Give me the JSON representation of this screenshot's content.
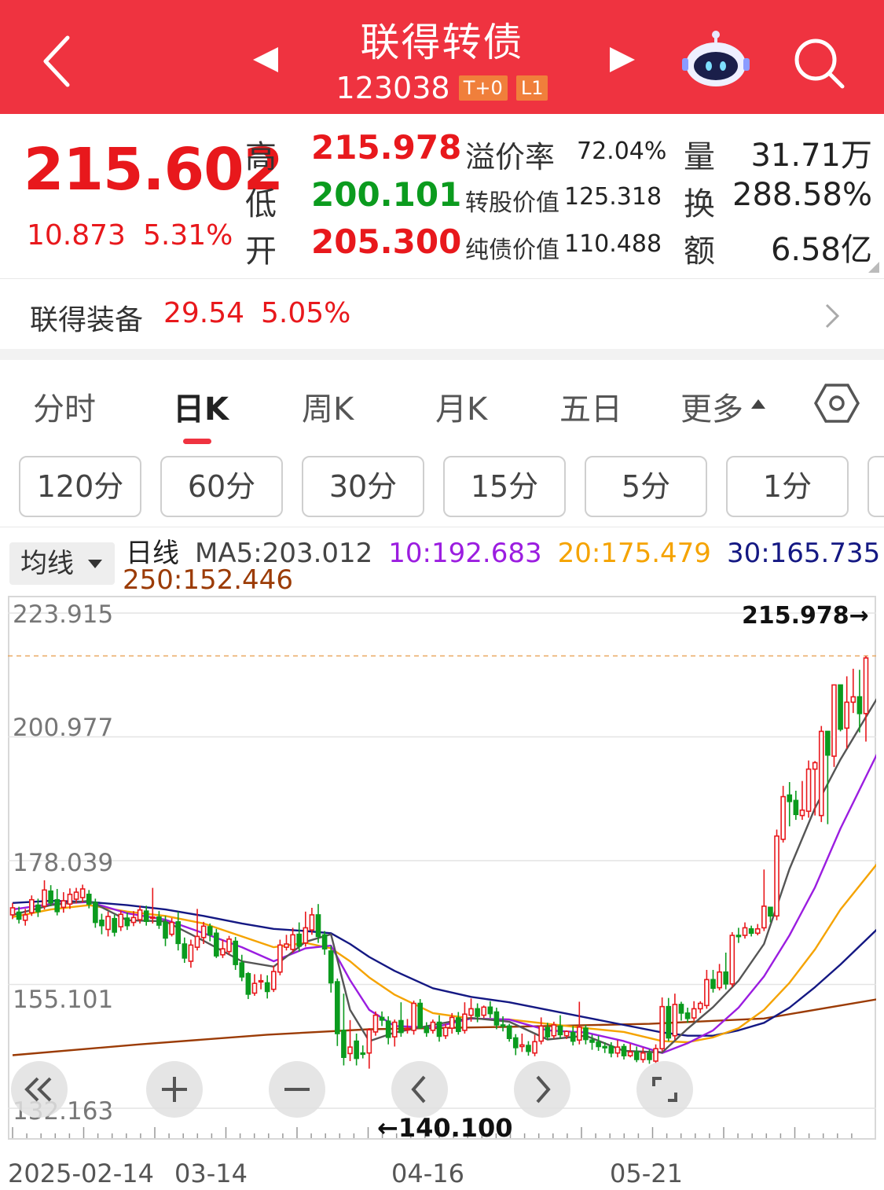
{
  "header": {
    "title": "联得转债",
    "code": "123038",
    "badge_t0": "T+0",
    "badge_l1": "L1"
  },
  "quote": {
    "price": "215.602",
    "change": "10.873",
    "change_pct": "5.31%",
    "high_label": "高",
    "high": "215.978",
    "low_label": "低",
    "low": "200.101",
    "open_label": "开",
    "open": "205.300",
    "premium_label": "溢价率",
    "premium": "72.04%",
    "conv_value_label": "转股价值",
    "conv_value": "125.318",
    "bond_value_label": "纯债价值",
    "bond_value": "110.488",
    "volume_label": "量",
    "volume": "31.71万",
    "turnover_label": "换",
    "turnover": "288.58%",
    "amount_label": "额",
    "amount": "6.58亿"
  },
  "underlying": {
    "name": "联得装备",
    "price": "29.54",
    "change_pct": "5.05%"
  },
  "tabs": {
    "items": [
      "分时",
      "日K",
      "周K",
      "月K",
      "五日",
      "更多"
    ],
    "active": "日K"
  },
  "intervals": [
    "120分",
    "60分",
    "30分",
    "15分",
    "5分",
    "1分"
  ],
  "ma": {
    "button": "均线",
    "period": "日线",
    "ma5": "MA5:203.012",
    "ma10": "10:192.683",
    "ma20": "20:175.479",
    "ma30": "30:165.735",
    "ma250": "250:152.446"
  },
  "colors": {
    "header_bg": "#ef3340",
    "up": "#e8181c",
    "down": "#0b9b1e",
    "ma5": "#555555",
    "ma10": "#9b1de0",
    "ma20": "#f5a300",
    "ma30": "#141883",
    "ma250": "#9b3b05"
  },
  "icons": [
    "back-icon",
    "prev-icon",
    "next-icon",
    "robot-icon",
    "search-icon",
    "chevron-right-icon",
    "settings-hex-icon",
    "double-left-icon",
    "zoom-in-icon",
    "zoom-out-icon",
    "scroll-left-icon",
    "scroll-right-icon",
    "fullscreen-icon"
  ],
  "chart_data": {
    "type": "candlestick",
    "y_ticks": [
      "223.915",
      "200.977",
      "178.039",
      "155.101",
      "132.163"
    ],
    "ylim": [
      132.163,
      223.915
    ],
    "x_ticks": [
      "2025-02-14",
      "03-14",
      "04-16",
      "05-21"
    ],
    "high_marker": "215.978→",
    "low_marker": "←140.100",
    "candles": [
      [
        168.0,
        169.3,
        170.2,
        167.2
      ],
      [
        168.5,
        167.2,
        169.5,
        166.4
      ],
      [
        167.0,
        168.0,
        169.1,
        166.0
      ],
      [
        168.4,
        170.8,
        171.6,
        167.8
      ],
      [
        169.8,
        168.6,
        171.0,
        167.6
      ],
      [
        169.6,
        172.6,
        174.4,
        169.0
      ],
      [
        172.4,
        170.2,
        173.5,
        169.6
      ],
      [
        170.8,
        168.6,
        172.8,
        167.9
      ],
      [
        169.4,
        170.6,
        172.2,
        168.4
      ],
      [
        170.0,
        171.8,
        172.9,
        169.1
      ],
      [
        170.9,
        172.2,
        173.0,
        170.1
      ],
      [
        171.2,
        172.8,
        173.6,
        170.3
      ],
      [
        171.8,
        170.0,
        172.6,
        169.2
      ],
      [
        170.3,
        166.6,
        171.0,
        165.6
      ],
      [
        167.0,
        166.0,
        168.2,
        164.4
      ],
      [
        165.3,
        167.7,
        168.6,
        164.0
      ],
      [
        167.3,
        164.8,
        168.0,
        164.0
      ],
      [
        165.8,
        168.1,
        168.8,
        165.0
      ],
      [
        167.4,
        166.0,
        168.4,
        165.2
      ],
      [
        166.6,
        167.5,
        168.7,
        165.9
      ],
      [
        167.1,
        168.9,
        169.7,
        166.4
      ],
      [
        168.7,
        166.8,
        169.7,
        166.0
      ],
      [
        167.5,
        167.6,
        173.0,
        166.4
      ],
      [
        167.6,
        166.1,
        168.7,
        165.4
      ],
      [
        166.6,
        163.7,
        167.8,
        162.2
      ],
      [
        164.4,
        166.6,
        167.4,
        164.0
      ],
      [
        166.7,
        162.7,
        168.6,
        161.4
      ],
      [
        162.6,
        160.0,
        163.8,
        159.1
      ],
      [
        159.4,
        162.4,
        163.4,
        158.2
      ],
      [
        162.0,
        164.0,
        169.1,
        161.4
      ],
      [
        163.8,
        165.9,
        166.7,
        162.6
      ],
      [
        165.8,
        164.3,
        166.4,
        163.1
      ],
      [
        164.6,
        160.4,
        165.4,
        160.0
      ],
      [
        160.6,
        161.7,
        163.4,
        160.0
      ],
      [
        161.2,
        163.5,
        164.1,
        160.6
      ],
      [
        163.1,
        158.8,
        163.9,
        157.8
      ],
      [
        159.1,
        156.5,
        160.6,
        155.7
      ],
      [
        157.1,
        153.3,
        157.4,
        152.4
      ],
      [
        153.5,
        155.3,
        157.0,
        153.0
      ],
      [
        155.6,
        155.8,
        157.0,
        154.2
      ],
      [
        155.4,
        153.8,
        156.8,
        152.5
      ],
      [
        154.2,
        157.5,
        158.6,
        153.7
      ],
      [
        157.4,
        162.4,
        163.4,
        156.8
      ],
      [
        162.0,
        162.6,
        164.3,
        161.4
      ],
      [
        161.6,
        164.3,
        165.6,
        161.0
      ],
      [
        164.4,
        162.2,
        166.6,
        161.2
      ],
      [
        162.8,
        165.6,
        168.6,
        162.1
      ],
      [
        165.2,
        168.0,
        169.3,
        164.3
      ],
      [
        168.0,
        164.0,
        170.0,
        162.8
      ],
      [
        164.3,
        161.7,
        165.0,
        160.6
      ],
      [
        161.3,
        155.4,
        162.3,
        153.6
      ],
      [
        155.6,
        146.0,
        156.2,
        143.7
      ],
      [
        146.6,
        141.6,
        153.4,
        140.1
      ],
      [
        142.3,
        143.5,
        148.5,
        140.9
      ],
      [
        144.6,
        141.4,
        146.0,
        140.1
      ],
      [
        142.4,
        142.2,
        143.8,
        141.4
      ],
      [
        142.4,
        146.7,
        147.0,
        139.5
      ],
      [
        146.3,
        149.4,
        150.1,
        145.6
      ],
      [
        149.0,
        148.5,
        150.1,
        147.4
      ],
      [
        148.3,
        145.3,
        149.2,
        144.0
      ],
      [
        145.4,
        148.1,
        148.6,
        143.6
      ],
      [
        148.4,
        146.2,
        151.8,
        145.4
      ],
      [
        146.8,
        146.9,
        148.7,
        146.0
      ],
      [
        146.6,
        151.6,
        152.1,
        145.8
      ],
      [
        151.6,
        147.1,
        152.4,
        146.8
      ],
      [
        147.2,
        146.2,
        148.1,
        145.4
      ],
      [
        146.6,
        148.1,
        148.6,
        146.0
      ],
      [
        148.1,
        145.5,
        149.4,
        144.5
      ],
      [
        145.6,
        147.1,
        147.8,
        145.0
      ],
      [
        147.0,
        149.0,
        149.8,
        146.0
      ],
      [
        148.9,
        146.4,
        150.0,
        145.8
      ],
      [
        146.6,
        149.6,
        151.8,
        146.0
      ],
      [
        149.4,
        150.6,
        152.5,
        148.2
      ],
      [
        150.6,
        149.2,
        151.6,
        148.1
      ],
      [
        149.4,
        150.9,
        151.2,
        148.9
      ],
      [
        150.9,
        149.7,
        152.0,
        148.9
      ],
      [
        150.0,
        147.6,
        150.8,
        146.8
      ],
      [
        147.6,
        147.4,
        149.2,
        146.4
      ],
      [
        147.4,
        145.1,
        147.8,
        144.5
      ],
      [
        145.2,
        143.4,
        145.9,
        142.0
      ],
      [
        143.6,
        143.9,
        146.0,
        142.6
      ],
      [
        143.8,
        142.7,
        144.6,
        141.9
      ],
      [
        142.4,
        144.5,
        145.8,
        141.8
      ],
      [
        144.6,
        147.4,
        149.0,
        144.0
      ],
      [
        147.1,
        145.4,
        148.0,
        144.8
      ],
      [
        145.6,
        147.6,
        148.2,
        145.1
      ],
      [
        147.4,
        145.8,
        149.4,
        145.0
      ],
      [
        145.6,
        146.4,
        146.6,
        145.0
      ],
      [
        146.2,
        144.6,
        147.4,
        143.8
      ],
      [
        144.8,
        147.2,
        151.9,
        144.0
      ],
      [
        147.0,
        144.9,
        147.6,
        144.0
      ],
      [
        144.8,
        144.4,
        145.8,
        143.0
      ],
      [
        144.4,
        143.6,
        145.6,
        142.8
      ],
      [
        143.6,
        143.5,
        144.4,
        142.4
      ],
      [
        143.6,
        142.4,
        144.4,
        141.6
      ],
      [
        142.4,
        143.5,
        144.8,
        141.6
      ],
      [
        143.6,
        141.9,
        144.1,
        141.2
      ],
      [
        141.9,
        142.6,
        144.1,
        141.6
      ],
      [
        142.6,
        141.2,
        143.6,
        140.7
      ],
      [
        141.2,
        142.4,
        143.4,
        140.6
      ],
      [
        142.3,
        141.2,
        143.1,
        140.4
      ],
      [
        140.9,
        143.2,
        144.0,
        140.5
      ],
      [
        143.2,
        151.0,
        152.7,
        142.7
      ],
      [
        151.0,
        145.2,
        152.6,
        144.6
      ],
      [
        145.6,
        151.4,
        153.4,
        144.8
      ],
      [
        151.4,
        149.8,
        151.9,
        148.4
      ],
      [
        149.8,
        148.8,
        150.8,
        148.0
      ],
      [
        148.9,
        150.6,
        152.0,
        148.4
      ],
      [
        150.6,
        151.6,
        152.0,
        149.8
      ],
      [
        151.2,
        156.0,
        157.8,
        150.6
      ],
      [
        156.0,
        154.4,
        157.8,
        153.6
      ],
      [
        154.5,
        157.4,
        158.9,
        154.0
      ],
      [
        157.4,
        155.2,
        161.0,
        154.2
      ],
      [
        155.2,
        164.2,
        164.8,
        154.6
      ],
      [
        164.2,
        164.0,
        165.6,
        162.8
      ],
      [
        164.2,
        165.6,
        166.6,
        163.6
      ],
      [
        165.4,
        164.6,
        166.0,
        164.0
      ],
      [
        164.6,
        165.4,
        166.3,
        164.2
      ],
      [
        165.6,
        169.6,
        176.4,
        165.0
      ],
      [
        169.4,
        167.8,
        169.4,
        166.6
      ],
      [
        167.8,
        182.6,
        183.8,
        167.0
      ],
      [
        182.0,
        189.9,
        191.9,
        181.4
      ],
      [
        190.2,
        189.0,
        192.6,
        184.4
      ],
      [
        189.2,
        186.6,
        191.0,
        185.6
      ],
      [
        186.4,
        187.4,
        192.8,
        185.6
      ],
      [
        187.2,
        195.0,
        196.6,
        186.0
      ],
      [
        195.0,
        196.2,
        196.5,
        186.4
      ],
      [
        186.4,
        202.0,
        203.0,
        185.2
      ],
      [
        202.0,
        197.6,
        202.0,
        184.8
      ],
      [
        197.4,
        210.6,
        210.6,
        195.4
      ],
      [
        210.6,
        202.4,
        210.6,
        202.0
      ],
      [
        202.6,
        207.4,
        212.2,
        198.8
      ],
      [
        207.4,
        208.4,
        213.6,
        205.4
      ],
      [
        208.4,
        205.3,
        213.4,
        201.8
      ],
      [
        205.3,
        215.6,
        215.978,
        200.101
      ]
    ],
    "ma_series": {
      "ma5": [
        [
          0,
          168.0
        ],
        [
          6,
          169.8
        ],
        [
          12,
          170.6
        ],
        [
          18,
          167.0
        ],
        [
          24,
          166.8
        ],
        [
          30,
          163.2
        ],
        [
          36,
          159.4
        ],
        [
          41,
          158.4
        ],
        [
          46,
          163.0
        ],
        [
          50,
          164.4
        ],
        [
          53,
          150.4
        ],
        [
          56,
          144.6
        ],
        [
          60,
          146.2
        ],
        [
          66,
          147.6
        ],
        [
          72,
          148.9
        ],
        [
          78,
          148.2
        ],
        [
          84,
          144.9
        ],
        [
          90,
          145.6
        ],
        [
          96,
          142.8
        ],
        [
          102,
          142.5
        ],
        [
          106,
          146.9
        ],
        [
          110,
          150.9
        ],
        [
          114,
          155.8
        ],
        [
          118,
          162.6
        ],
        [
          122,
          176.5
        ],
        [
          126,
          187.8
        ],
        [
          130,
          196.8
        ],
        [
          136,
          208.6
        ]
      ],
      "ma10": [
        [
          0,
          169.0
        ],
        [
          6,
          170.0
        ],
        [
          12,
          170.4
        ],
        [
          18,
          168.3
        ],
        [
          24,
          167.1
        ],
        [
          30,
          164.6
        ],
        [
          36,
          162.0
        ],
        [
          41,
          159.4
        ],
        [
          46,
          161.8
        ],
        [
          50,
          162.3
        ],
        [
          53,
          155.9
        ],
        [
          56,
          150.4
        ],
        [
          60,
          147.4
        ],
        [
          66,
          147.1
        ],
        [
          72,
          148.8
        ],
        [
          78,
          148.6
        ],
        [
          84,
          146.6
        ],
        [
          90,
          146.2
        ],
        [
          96,
          144.6
        ],
        [
          102,
          142.4
        ],
        [
          106,
          144.2
        ],
        [
          110,
          146.6
        ],
        [
          114,
          150.8
        ],
        [
          118,
          156.6
        ],
        [
          122,
          164.2
        ],
        [
          126,
          173.1
        ],
        [
          130,
          184.0
        ],
        [
          136,
          198.4
        ]
      ],
      "ma20": [
        [
          0,
          167.6
        ],
        [
          6,
          169.0
        ],
        [
          12,
          169.8
        ],
        [
          18,
          168.6
        ],
        [
          24,
          167.8
        ],
        [
          30,
          166.4
        ],
        [
          36,
          164.0
        ],
        [
          41,
          162.0
        ],
        [
          46,
          162.8
        ],
        [
          50,
          161.8
        ],
        [
          53,
          159.4
        ],
        [
          56,
          156.4
        ],
        [
          60,
          153.2
        ],
        [
          66,
          149.8
        ],
        [
          72,
          148.8
        ],
        [
          78,
          148.6
        ],
        [
          84,
          147.8
        ],
        [
          90,
          147.0
        ],
        [
          96,
          146.3
        ],
        [
          102,
          144.6
        ],
        [
          106,
          144.4
        ],
        [
          110,
          145.3
        ],
        [
          114,
          147.0
        ],
        [
          118,
          150.4
        ],
        [
          122,
          155.4
        ],
        [
          126,
          161.6
        ],
        [
          130,
          169.0
        ],
        [
          136,
          177.8
        ]
      ],
      "ma30": [
        [
          0,
          170.2
        ],
        [
          6,
          170.6
        ],
        [
          12,
          170.4
        ],
        [
          18,
          169.8
        ],
        [
          24,
          169.0
        ],
        [
          30,
          167.8
        ],
        [
          36,
          166.4
        ],
        [
          41,
          165.4
        ],
        [
          46,
          165.0
        ],
        [
          50,
          164.6
        ],
        [
          53,
          162.6
        ],
        [
          56,
          160.2
        ],
        [
          60,
          157.6
        ],
        [
          66,
          154.4
        ],
        [
          72,
          152.8
        ],
        [
          78,
          151.8
        ],
        [
          84,
          150.4
        ],
        [
          90,
          149.0
        ],
        [
          96,
          147.6
        ],
        [
          102,
          146.2
        ],
        [
          106,
          145.6
        ],
        [
          110,
          145.6
        ],
        [
          114,
          146.6
        ],
        [
          118,
          148.0
        ],
        [
          122,
          150.8
        ],
        [
          126,
          154.6
        ],
        [
          130,
          158.8
        ],
        [
          136,
          165.6
        ]
      ],
      "ma250": [
        [
          0,
          142.0
        ],
        [
          20,
          144.0
        ],
        [
          40,
          145.8
        ],
        [
          56,
          146.8
        ],
        [
          80,
          147.3
        ],
        [
          100,
          147.8
        ],
        [
          118,
          148.8
        ],
        [
          136,
          152.4
        ]
      ]
    }
  }
}
